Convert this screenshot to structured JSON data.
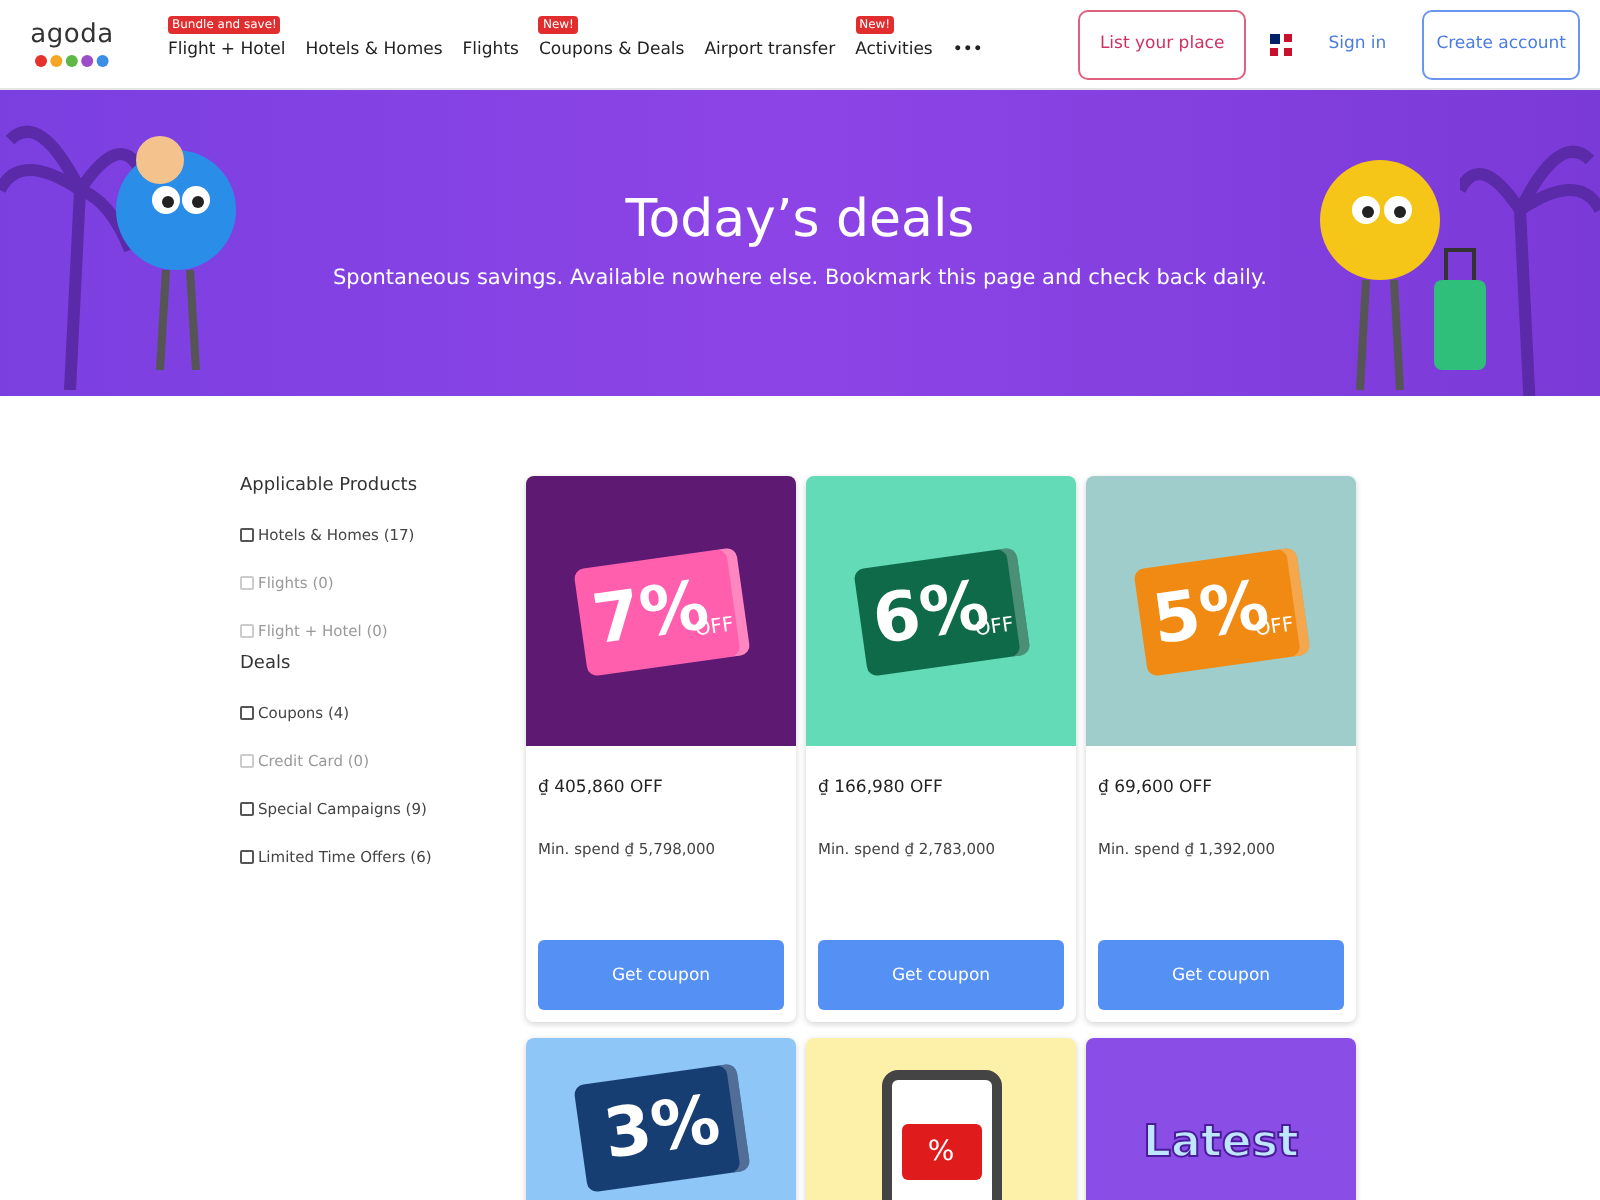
{
  "header": {
    "logo": "agoda",
    "nav": [
      {
        "label": "Flight + Hotel",
        "badge": "Bundle and save!"
      },
      {
        "label": "Hotels & Homes"
      },
      {
        "label": "Flights"
      },
      {
        "label": "Coupons & Deals",
        "badge": "New!"
      },
      {
        "label": "Airport transfer"
      },
      {
        "label": "Activities",
        "badge": "New!"
      },
      {
        "label": "•••"
      }
    ],
    "list_place": "List your place",
    "sign_in": "Sign in",
    "create_account": "Create account"
  },
  "hero": {
    "title": "Today’s deals",
    "subtitle": "Spontaneous savings. Available nowhere else. Bookmark this page and check back daily."
  },
  "filters": [
    {
      "heading": "Applicable Products",
      "options": [
        {
          "label": "Hotels & Homes (17)",
          "checked": false,
          "disabled": false
        },
        {
          "label": "Flights (0)",
          "checked": false,
          "disabled": true
        },
        {
          "label": "Flight + Hotel (0)",
          "checked": false,
          "disabled": true
        }
      ]
    },
    {
      "heading": "Deals",
      "options": [
        {
          "label": "Coupons (4)",
          "checked": false,
          "disabled": false
        },
        {
          "label": "Credit Card (0)",
          "checked": false,
          "disabled": true
        },
        {
          "label": "Special Campaigns (9)",
          "checked": false,
          "disabled": false
        },
        {
          "label": "Limited Time Offers (6)",
          "checked": false,
          "disabled": false
        }
      ]
    }
  ],
  "coupons": [
    {
      "kind": "ticket",
      "percent": "7%",
      "off": "OFF",
      "color": "#ff5fad",
      "amount": "₫ 405,860 OFF",
      "min_spend": "Min. spend ₫ 5,798,000",
      "button": "Get coupon"
    },
    {
      "kind": "ticket",
      "percent": "6%",
      "off": "OFF",
      "color": "#0e6a48",
      "amount": "₫ 166,980 OFF",
      "min_spend": "Min. spend ₫ 2,783,000",
      "button": "Get coupon"
    },
    {
      "kind": "ticket",
      "percent": "5%",
      "off": "OFF",
      "color": "#f08a12",
      "amount": "₫ 69,600 OFF",
      "min_spend": "Min. spend ₫ 1,392,000",
      "button": "Get coupon"
    },
    {
      "kind": "ticket",
      "percent": "3%",
      "color": "#163e73"
    },
    {
      "kind": "phone",
      "percent": "%",
      "color": "#e01b1b"
    },
    {
      "kind": "banner",
      "percent": "Latest",
      "color": "#8a4de6"
    }
  ]
}
